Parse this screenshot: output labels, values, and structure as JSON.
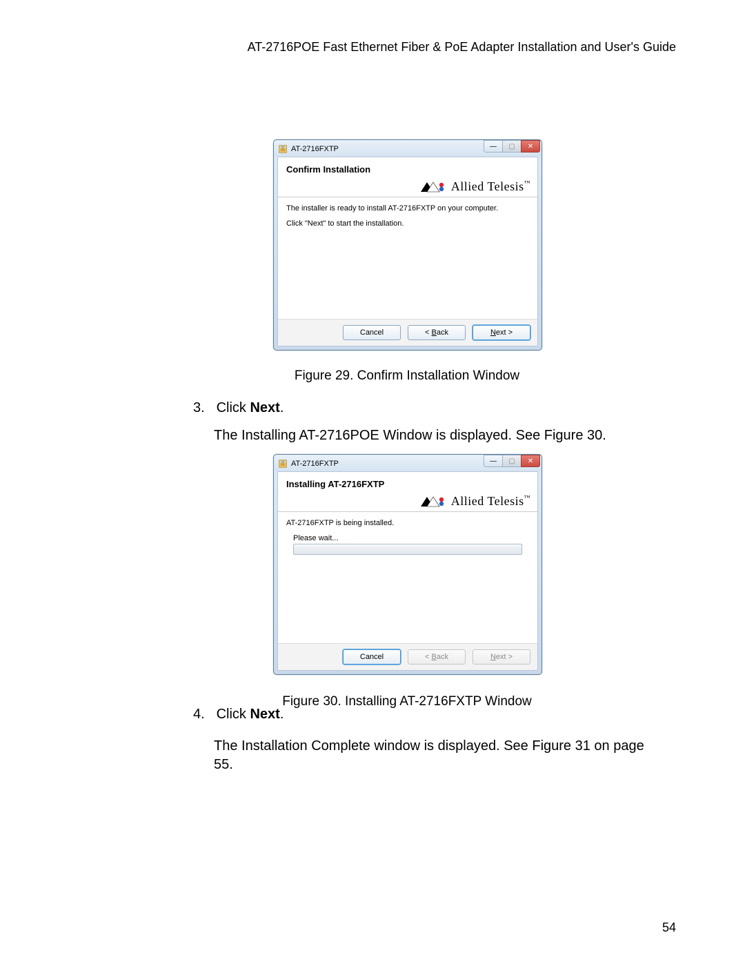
{
  "header": "AT-2716POE Fast Ethernet Fiber & PoE Adapter Installation and User's Guide",
  "page_number": "54",
  "brand": "Allied Telesis",
  "tm": "™",
  "figure29": {
    "caption": "Figure 29. Confirm Installation Window",
    "title": "AT-2716FXTP",
    "heading": "Confirm Installation",
    "line1": "The installer is ready to install AT-2716FXTP on your computer.",
    "line2": "Click \"Next\" to start the installation.",
    "buttons": {
      "cancel": "Cancel",
      "back": "< Back",
      "next": "Next >"
    }
  },
  "figure30": {
    "caption": "Figure 30. Installing AT-2716FXTP Window",
    "title": "AT-2716FXTP",
    "heading": "Installing AT-2716FXTP",
    "line1": "AT-2716FXTP is being installed.",
    "progress_label": "Please wait...",
    "buttons": {
      "cancel": "Cancel",
      "back": "< Back",
      "next": "Next >"
    }
  },
  "steps": {
    "s3_num": "3.",
    "s3_text_a": "Click ",
    "s3_text_b": "Next",
    "s3_text_c": ".",
    "s3_follow": "The Installing AT-2716POE Window is displayed. See Figure 30.",
    "s4_num": "4.",
    "s4_text_a": "Click ",
    "s4_text_b": "Next",
    "s4_text_c": ".",
    "s4_follow": "The Installation Complete window is displayed. See Figure 31 on page 55."
  }
}
